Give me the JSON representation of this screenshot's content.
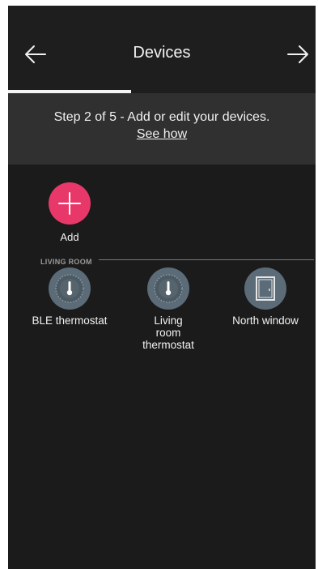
{
  "header": {
    "title": "Devices"
  },
  "progress": {
    "current_step": 2,
    "total_steps": 5
  },
  "step_banner": {
    "text": "Step 2 of 5 - Add or edit your devices.",
    "link": "See how"
  },
  "add_button": {
    "label": "Add",
    "color": "#e8386a"
  },
  "section": {
    "label": "LIVING ROOM"
  },
  "devices": [
    {
      "label": "BLE thermostat",
      "icon": "thermostat-icon"
    },
    {
      "label": "Living room thermostat",
      "icon": "thermostat-icon"
    },
    {
      "label": "North window",
      "icon": "window-icon"
    }
  ],
  "colors": {
    "background": "#1b1b1b",
    "banner": "#303030",
    "device_icon": "#5b6b77"
  }
}
